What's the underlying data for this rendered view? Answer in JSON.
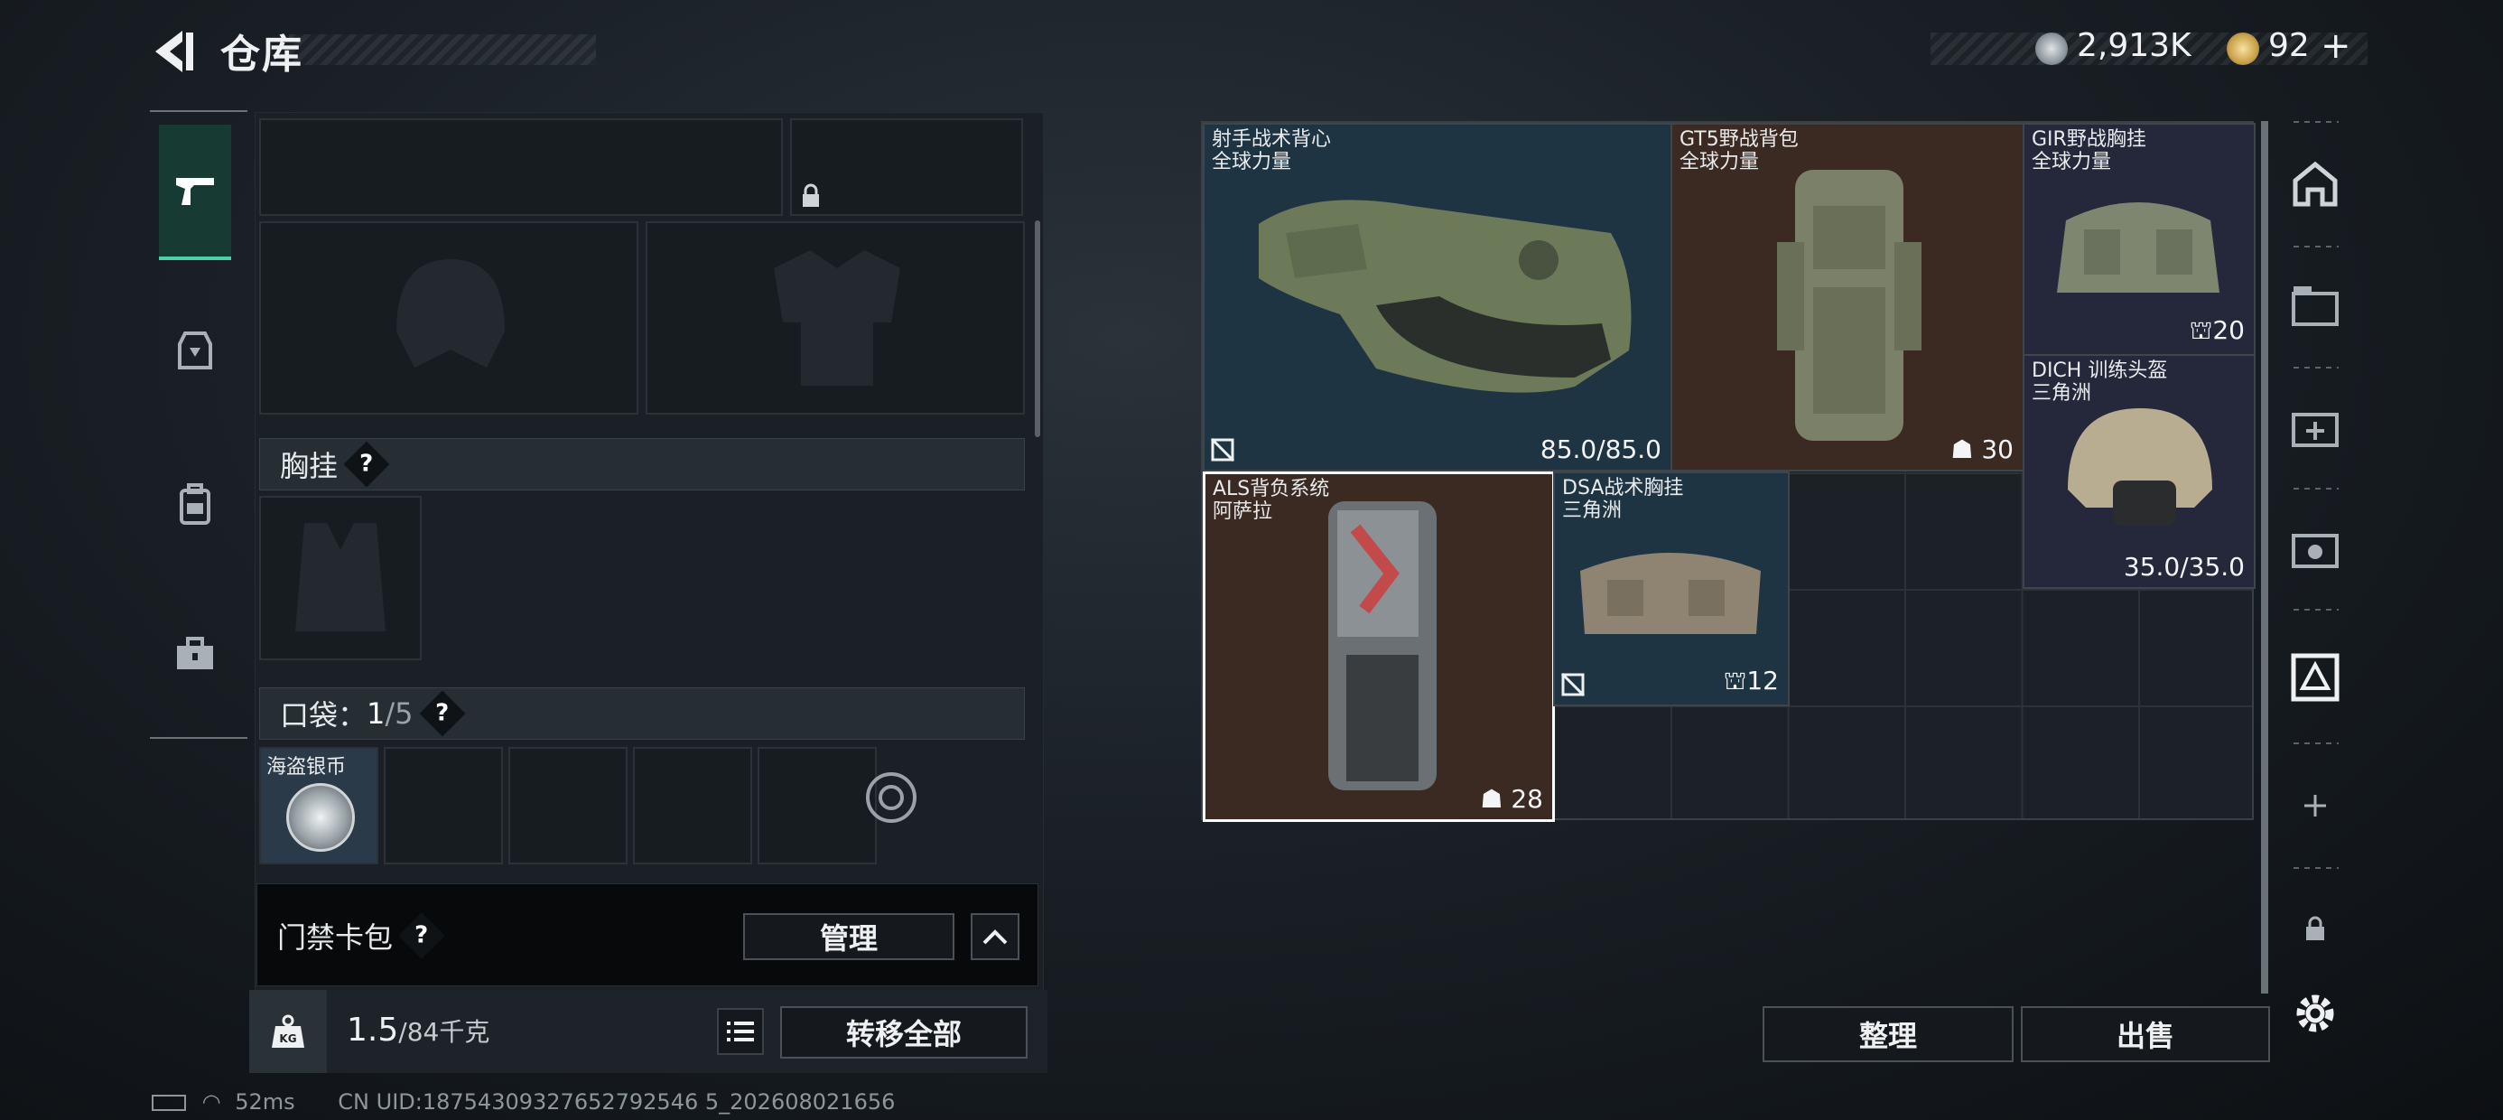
{
  "header": {
    "title": "仓库",
    "currency_silver": "2,913K",
    "currency_gold": "92",
    "plus": "+"
  },
  "left_panel": {
    "chest_rig_section": "胸挂",
    "pocket_section_label": "口袋：",
    "pocket_count": "1",
    "pocket_total": "/5",
    "help": "?",
    "pocket_item_name": "海盗银币",
    "keycard_label": "门禁卡包",
    "manage_button": "管理",
    "weight_value": "1.5",
    "weight_limit": "/84千克",
    "transfer_all_button": "转移全部",
    "weight_icon_text": "KG"
  },
  "items": [
    {
      "name": "射手战术背心",
      "sub": "全球力量",
      "value": "85.0/85.0",
      "bg": "#1f3442"
    },
    {
      "name": "GT5野战背包",
      "sub": "全球力量",
      "value": "30",
      "bg": "#3a2a22"
    },
    {
      "name": "GIR野战胸挂",
      "sub": "全球力量",
      "value": "20",
      "bg": "#24283a"
    },
    {
      "name": "DICH 训练头盔",
      "sub": "三角洲",
      "value": "35.0/35.0",
      "bg": "#24283a"
    },
    {
      "name": "ALS背负系统",
      "sub": "阿萨拉",
      "value": "28",
      "bg": "#3a2a22"
    },
    {
      "name": "DSA战术胸挂",
      "sub": "三角洲",
      "value": "12",
      "bg": "#1f3442"
    }
  ],
  "buttons": {
    "sort": "整理",
    "sell": "出售"
  },
  "status_bar": {
    "ping": "52ms",
    "uid": "CN UID:18754309327652792546 5_202608021656"
  },
  "icons": [
    "back-arrow-icon",
    "silver-coin-icon",
    "gold-coin-icon",
    "pistol-icon",
    "armor-icon",
    "backpack-icon",
    "toolbox-icon",
    "lock-icon",
    "kg-weight-icon",
    "list-icon",
    "chevron-up-icon",
    "gear-icon",
    "plus-icon",
    "no-repair-icon",
    "durability-icon"
  ],
  "colors": {
    "accent": "#4ecfa8",
    "selected_border": "#ffffff"
  }
}
